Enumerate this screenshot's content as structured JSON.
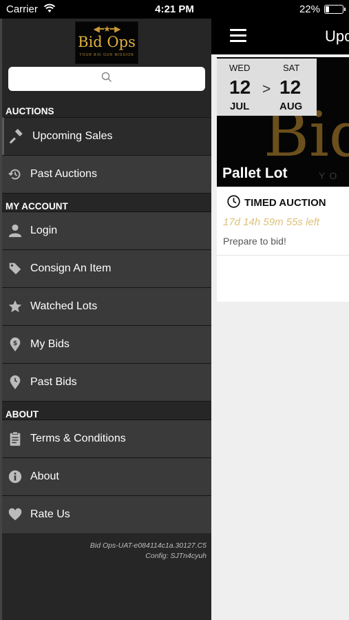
{
  "status_bar": {
    "carrier": "Carrier",
    "time": "4:21 PM",
    "battery_percent": "22%",
    "battery_level": 0.22,
    "wifi_icon": "wifi-icon"
  },
  "drawer": {
    "logo": {
      "name": "Bid Ops",
      "tagline": "YOUR BID OUR MISSION"
    },
    "search": {
      "placeholder": "",
      "icon": "search-icon"
    },
    "sections": {
      "auctions": "AUCTIONS",
      "my_account": "MY ACCOUNT",
      "about": "ABOUT"
    },
    "items": {
      "upcoming_sales": {
        "label": "Upcoming Sales",
        "icon": "gavel-icon",
        "active": true
      },
      "past_auctions": {
        "label": "Past Auctions",
        "icon": "history-icon"
      },
      "login": {
        "label": "Login",
        "icon": "user-icon"
      },
      "consign": {
        "label": "Consign An Item",
        "icon": "tag-icon"
      },
      "watched_lots": {
        "label": "Watched Lots",
        "icon": "star-icon"
      },
      "my_bids": {
        "label": "My Bids",
        "icon": "dollar-pin-icon"
      },
      "past_bids": {
        "label": "Past Bids",
        "icon": "clock-pin-icon"
      },
      "terms": {
        "label": "Terms & Conditions",
        "icon": "clipboard-icon"
      },
      "about": {
        "label": "About",
        "icon": "info-icon"
      },
      "rate_us": {
        "label": "Rate Us",
        "icon": "heart-icon"
      }
    },
    "version": {
      "build": "Bid Ops-UAT-e084114c1a.30127.C5",
      "config": "Config: SJTn4cyuh"
    }
  },
  "main": {
    "title": "Upcoming Sales",
    "menu_icon": "hamburger-icon",
    "card": {
      "start": {
        "dow": "WED",
        "day": "12",
        "month": "JUL"
      },
      "end": {
        "dow": "SAT",
        "day": "12",
        "month": "AUG"
      },
      "arrow": ">",
      "image_text": "Bid",
      "image_subtext": "YO",
      "lot_title": "Pallet Lot",
      "auction_type": "TIMED AUCTION",
      "countdown": "17d 14h 59m 55s left",
      "status": "Prepare to bid!"
    }
  },
  "colors": {
    "drawer_bg": "#262626",
    "item_bg": "#3a3a3a",
    "accent_gold": "#e0b13f",
    "countdown": "#dcc27a"
  }
}
